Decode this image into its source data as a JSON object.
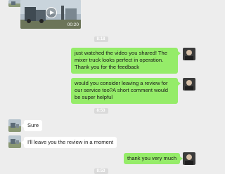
{
  "video": {
    "duration": "00:20",
    "play_icon": "play-icon"
  },
  "timestamps": [
    "8:18",
    "8:53",
    "8:53"
  ],
  "messages": [
    {
      "side": "right",
      "text": "just watched the video you shared! The mixer truck looks perfect in operation. Thank you for the feedback"
    },
    {
      "side": "right",
      "text": "would you consider leaving a review for our service too?A short comment would be super helpful"
    },
    {
      "side": "left",
      "text": "Sure"
    },
    {
      "side": "left",
      "text": "I'll leave you the review in a moment"
    },
    {
      "side": "right",
      "text": "thank you very much"
    }
  ],
  "colors": {
    "background": "#ededed",
    "sent_bubble": "#95ec69",
    "received_bubble": "#ffffff",
    "timestamp_pill": "#dadada"
  }
}
